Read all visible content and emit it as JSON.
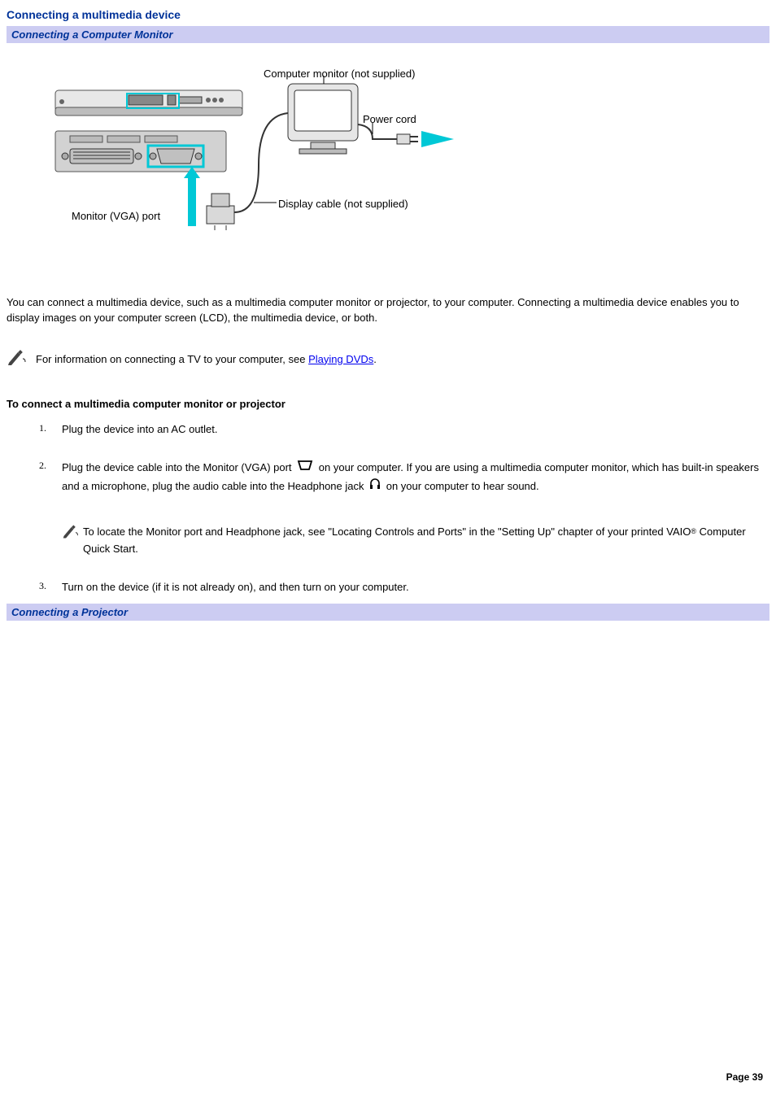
{
  "title": "Connecting a multimedia device",
  "subbar1": "Connecting a Computer Monitor",
  "diagram": {
    "label_monitor_not_supplied": "Computer monitor (not supplied)",
    "label_power_cord": "Power cord",
    "label_display_cable": "Display cable (not supplied)",
    "label_vga_port": "Monitor (VGA) port"
  },
  "intro": "You can connect a multimedia device, such as a multimedia computer monitor or projector, to your computer. Connecting a multimedia device enables you to display images on your computer screen (LCD), the multimedia device, or both.",
  "note1_prefix": "For information on connecting a TV to your computer, see ",
  "note1_link": "Playing DVDs",
  "note1_suffix": ".",
  "section_heading": "To connect a multimedia computer monitor or projector",
  "steps": {
    "s1": "Plug the device into an AC outlet.",
    "s2a": "Plug the device cable into the Monitor (VGA) port ",
    "s2b": " on your computer. If you are using a multimedia computer monitor, which has built-in speakers and a microphone, plug the audio cable into the Headphone jack ",
    "s2c": " on your computer to hear sound.",
    "s2_note_a": "To locate the Monitor port and Headphone jack, see \"Locating Controls and Ports\" in the \"Setting Up\" chapter of your printed VAIO",
    "s2_note_b": " Computer Quick Start.",
    "s3": "Turn on the device (if it is not already on), and then turn on your computer."
  },
  "subbar2": "Connecting a Projector",
  "page_label": "Page 39"
}
